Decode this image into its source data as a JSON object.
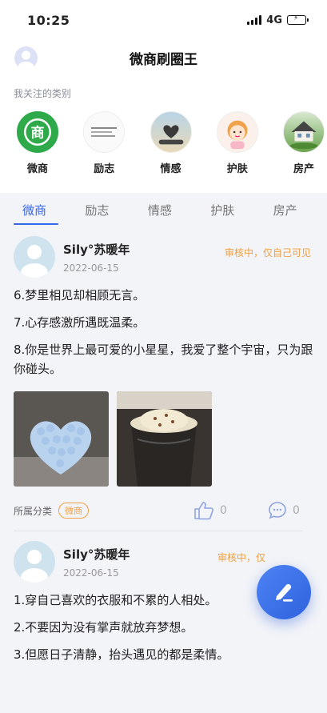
{
  "status_bar": {
    "time": "10:25",
    "network": "4G"
  },
  "header": {
    "title": "微商刷圈王"
  },
  "categories": {
    "section_title": "我关注的类别",
    "items": [
      {
        "label": "微商",
        "icon": "shang-badge-icon",
        "color": "#2faa4a"
      },
      {
        "label": "励志",
        "icon": "text-image-icon"
      },
      {
        "label": "情感",
        "icon": "heart-hands-icon"
      },
      {
        "label": "护肤",
        "icon": "cartoon-girl-icon"
      },
      {
        "label": "房产",
        "icon": "house-icon"
      }
    ]
  },
  "tabs": [
    {
      "label": "微商",
      "active": true
    },
    {
      "label": "励志"
    },
    {
      "label": "情感"
    },
    {
      "label": "护肤"
    },
    {
      "label": "房产"
    }
  ],
  "posts": [
    {
      "user": "Sily°苏暖年",
      "date": "2022-06-15",
      "status": "审核中，仅自己可见",
      "lines": [
        "6.梦里相见却相顾无言。",
        "7.心存感激所遇既温柔。",
        "8.你是世界上最可爱的小星星，我爱了整个宇宙，只为跟你碰头。"
      ],
      "category_label": "所属分类",
      "category_tag": "微商",
      "likes": "0",
      "comments": "0"
    },
    {
      "user": "Sily°苏暖年",
      "date": "2022-06-15",
      "status": "审核中，仅",
      "lines": [
        "1.穿自己喜欢的衣服和不累的人相处。",
        "2.不要因为没有掌声就放弃梦想。",
        "3.但愿日子清静，抬头遇见的都是柔情。"
      ]
    }
  ],
  "colors": {
    "accent": "#3a66e8",
    "status": "#f0a040"
  }
}
